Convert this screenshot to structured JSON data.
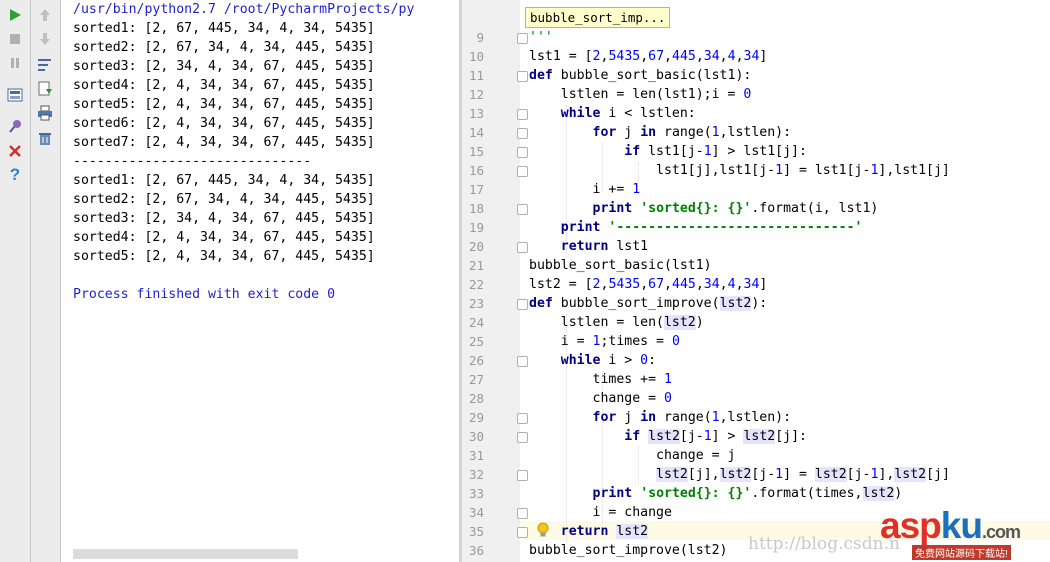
{
  "toolbar_left": {
    "run_icon_color": "#2e9f3a",
    "stop_icon_color": "#b0b0b0",
    "close_icon_color": "#d03030",
    "help_icon_color": "#3080d0"
  },
  "console": {
    "command": "/usr/bin/python2.7 /root/PycharmProjects/py",
    "lines": [
      "sorted1: [2, 67, 445, 34, 4, 34, 5435]",
      "sorted2: [2, 67, 34, 4, 34, 445, 5435]",
      "sorted3: [2, 34, 4, 34, 67, 445, 5435]",
      "sorted4: [2, 4, 34, 34, 67, 445, 5435]",
      "sorted5: [2, 4, 34, 34, 67, 445, 5435]",
      "sorted6: [2, 4, 34, 34, 67, 445, 5435]",
      "sorted7: [2, 4, 34, 34, 67, 445, 5435]",
      "------------------------------",
      "sorted1: [2, 67, 445, 34, 4, 34, 5435]",
      "sorted2: [2, 67, 34, 4, 34, 445, 5435]",
      "sorted3: [2, 34, 4, 34, 67, 445, 5435]",
      "sorted4: [2, 4, 34, 34, 67, 445, 5435]",
      "sorted5: [2, 4, 34, 34, 67, 445, 5435]",
      "",
      "Process finished with exit code 0"
    ]
  },
  "editor": {
    "tooltip": "bubble_sort_imp...",
    "line_numbers": [
      "9",
      "10",
      "11",
      "12",
      "13",
      "14",
      "15",
      "16",
      "17",
      "18",
      "19",
      "20",
      "21",
      "22",
      "23",
      "24",
      "25",
      "26",
      "27",
      "28",
      "29",
      "30",
      "31",
      "32",
      "33",
      "34",
      "35",
      "36"
    ],
    "l9": "'''",
    "l10": {
      "a": "lst1 = [",
      "n1": "2",
      "c1": ",",
      "n2": "5435",
      "c2": ",",
      "n3": "67",
      "c3": ",",
      "n4": "445",
      "c4": ",",
      "n5": "34",
      "c5": ",",
      "n6": "4",
      "c6": ",",
      "n7": "34",
      "z": "]"
    },
    "l11": {
      "kw": "def",
      "rest": " bubble_sort_basic(lst1):"
    },
    "l12": {
      "a": "    lstlen = len(lst1);i = ",
      "n": "0"
    },
    "l13": {
      "ind": "    ",
      "kw": "while",
      "rest": " i < lstlen:"
    },
    "l14": {
      "ind": "        ",
      "kw1": "for",
      "mid": " j ",
      "kw2": "in",
      "a": " range(",
      "n": "1",
      "z": ",lstlen):"
    },
    "l15": {
      "ind": "            ",
      "kw": "if",
      "a": " lst1[j-",
      "n": "1",
      "z": "] > lst1[j]:"
    },
    "l16": {
      "a": "                lst1[j],lst1[j-",
      "n1": "1",
      "b": "] = lst1[j-",
      "n2": "1",
      "z": "],lst1[j]"
    },
    "l17": {
      "a": "        i += ",
      "n": "1"
    },
    "l18": {
      "ind": "        ",
      "kw": "print",
      "sp": " ",
      "str": "'sorted{}: {}'",
      "z": ".format(i, lst1)"
    },
    "l19": {
      "ind": "    ",
      "kw": "print",
      "sp": " ",
      "str": "'------------------------------'"
    },
    "l20": {
      "ind": "    ",
      "kw": "return",
      "rest": " lst1"
    },
    "l21": "bubble_sort_basic(lst1)",
    "l22": {
      "a": "lst2 = [",
      "n1": "2",
      "c1": ",",
      "n2": "5435",
      "c2": ",",
      "n3": "67",
      "c3": ",",
      "n4": "445",
      "c4": ",",
      "n5": "34",
      "c5": ",",
      "n6": "4",
      "c6": ",",
      "n7": "34",
      "z": "]"
    },
    "l23": {
      "kw": "def",
      "a": " bubble_sort_improve(",
      "p": "lst2",
      "z": "):"
    },
    "l24": {
      "a": "    lstlen = len(",
      "p": "lst2",
      "z": ")"
    },
    "l25": {
      "a": "    i = ",
      "n1": "1",
      "b": ";times = ",
      "n2": "0"
    },
    "l26": {
      "ind": "    ",
      "kw": "while",
      "a": " i > ",
      "n": "0",
      "z": ":"
    },
    "l27": {
      "a": "        times += ",
      "n": "1"
    },
    "l28": {
      "a": "        change = ",
      "n": "0"
    },
    "l29": {
      "ind": "        ",
      "kw1": "for",
      "mid": " j ",
      "kw2": "in",
      "a": " range(",
      "n": "1",
      "z": ",lstlen):"
    },
    "l30": {
      "ind": "            ",
      "kw": "if",
      "sp": " ",
      "p1": "lst2",
      "a": "[j-",
      "n": "1",
      "b": "] > ",
      "p2": "lst2",
      "z": "[j]:"
    },
    "l31": "                change = j",
    "l32": {
      "ind": "                ",
      "p1": "lst2",
      "a": "[j],",
      "p2": "lst2",
      "b": "[j-",
      "n1": "1",
      "c": "] = ",
      "p3": "lst2",
      "d": "[j-",
      "n2": "1",
      "e": "],",
      "p4": "lst2",
      "z": "[j]"
    },
    "l33": {
      "ind": "        ",
      "kw": "print",
      "sp": " ",
      "str": "'sorted{}: {}'",
      "a": ".format(times,",
      "p": "lst2",
      "z": ")"
    },
    "l34": "        i = change",
    "l35": {
      "ind": "    ",
      "kw": "return",
      "sp": " ",
      "p": "lst2"
    },
    "l36": "bubble_sort_improve(lst2)"
  },
  "watermark": {
    "url": "http://blog.csdn.n",
    "logo_a": "asp",
    "logo_b": "ku",
    "logo_c": ".com",
    "sub": "免费网站源码下载站!"
  }
}
